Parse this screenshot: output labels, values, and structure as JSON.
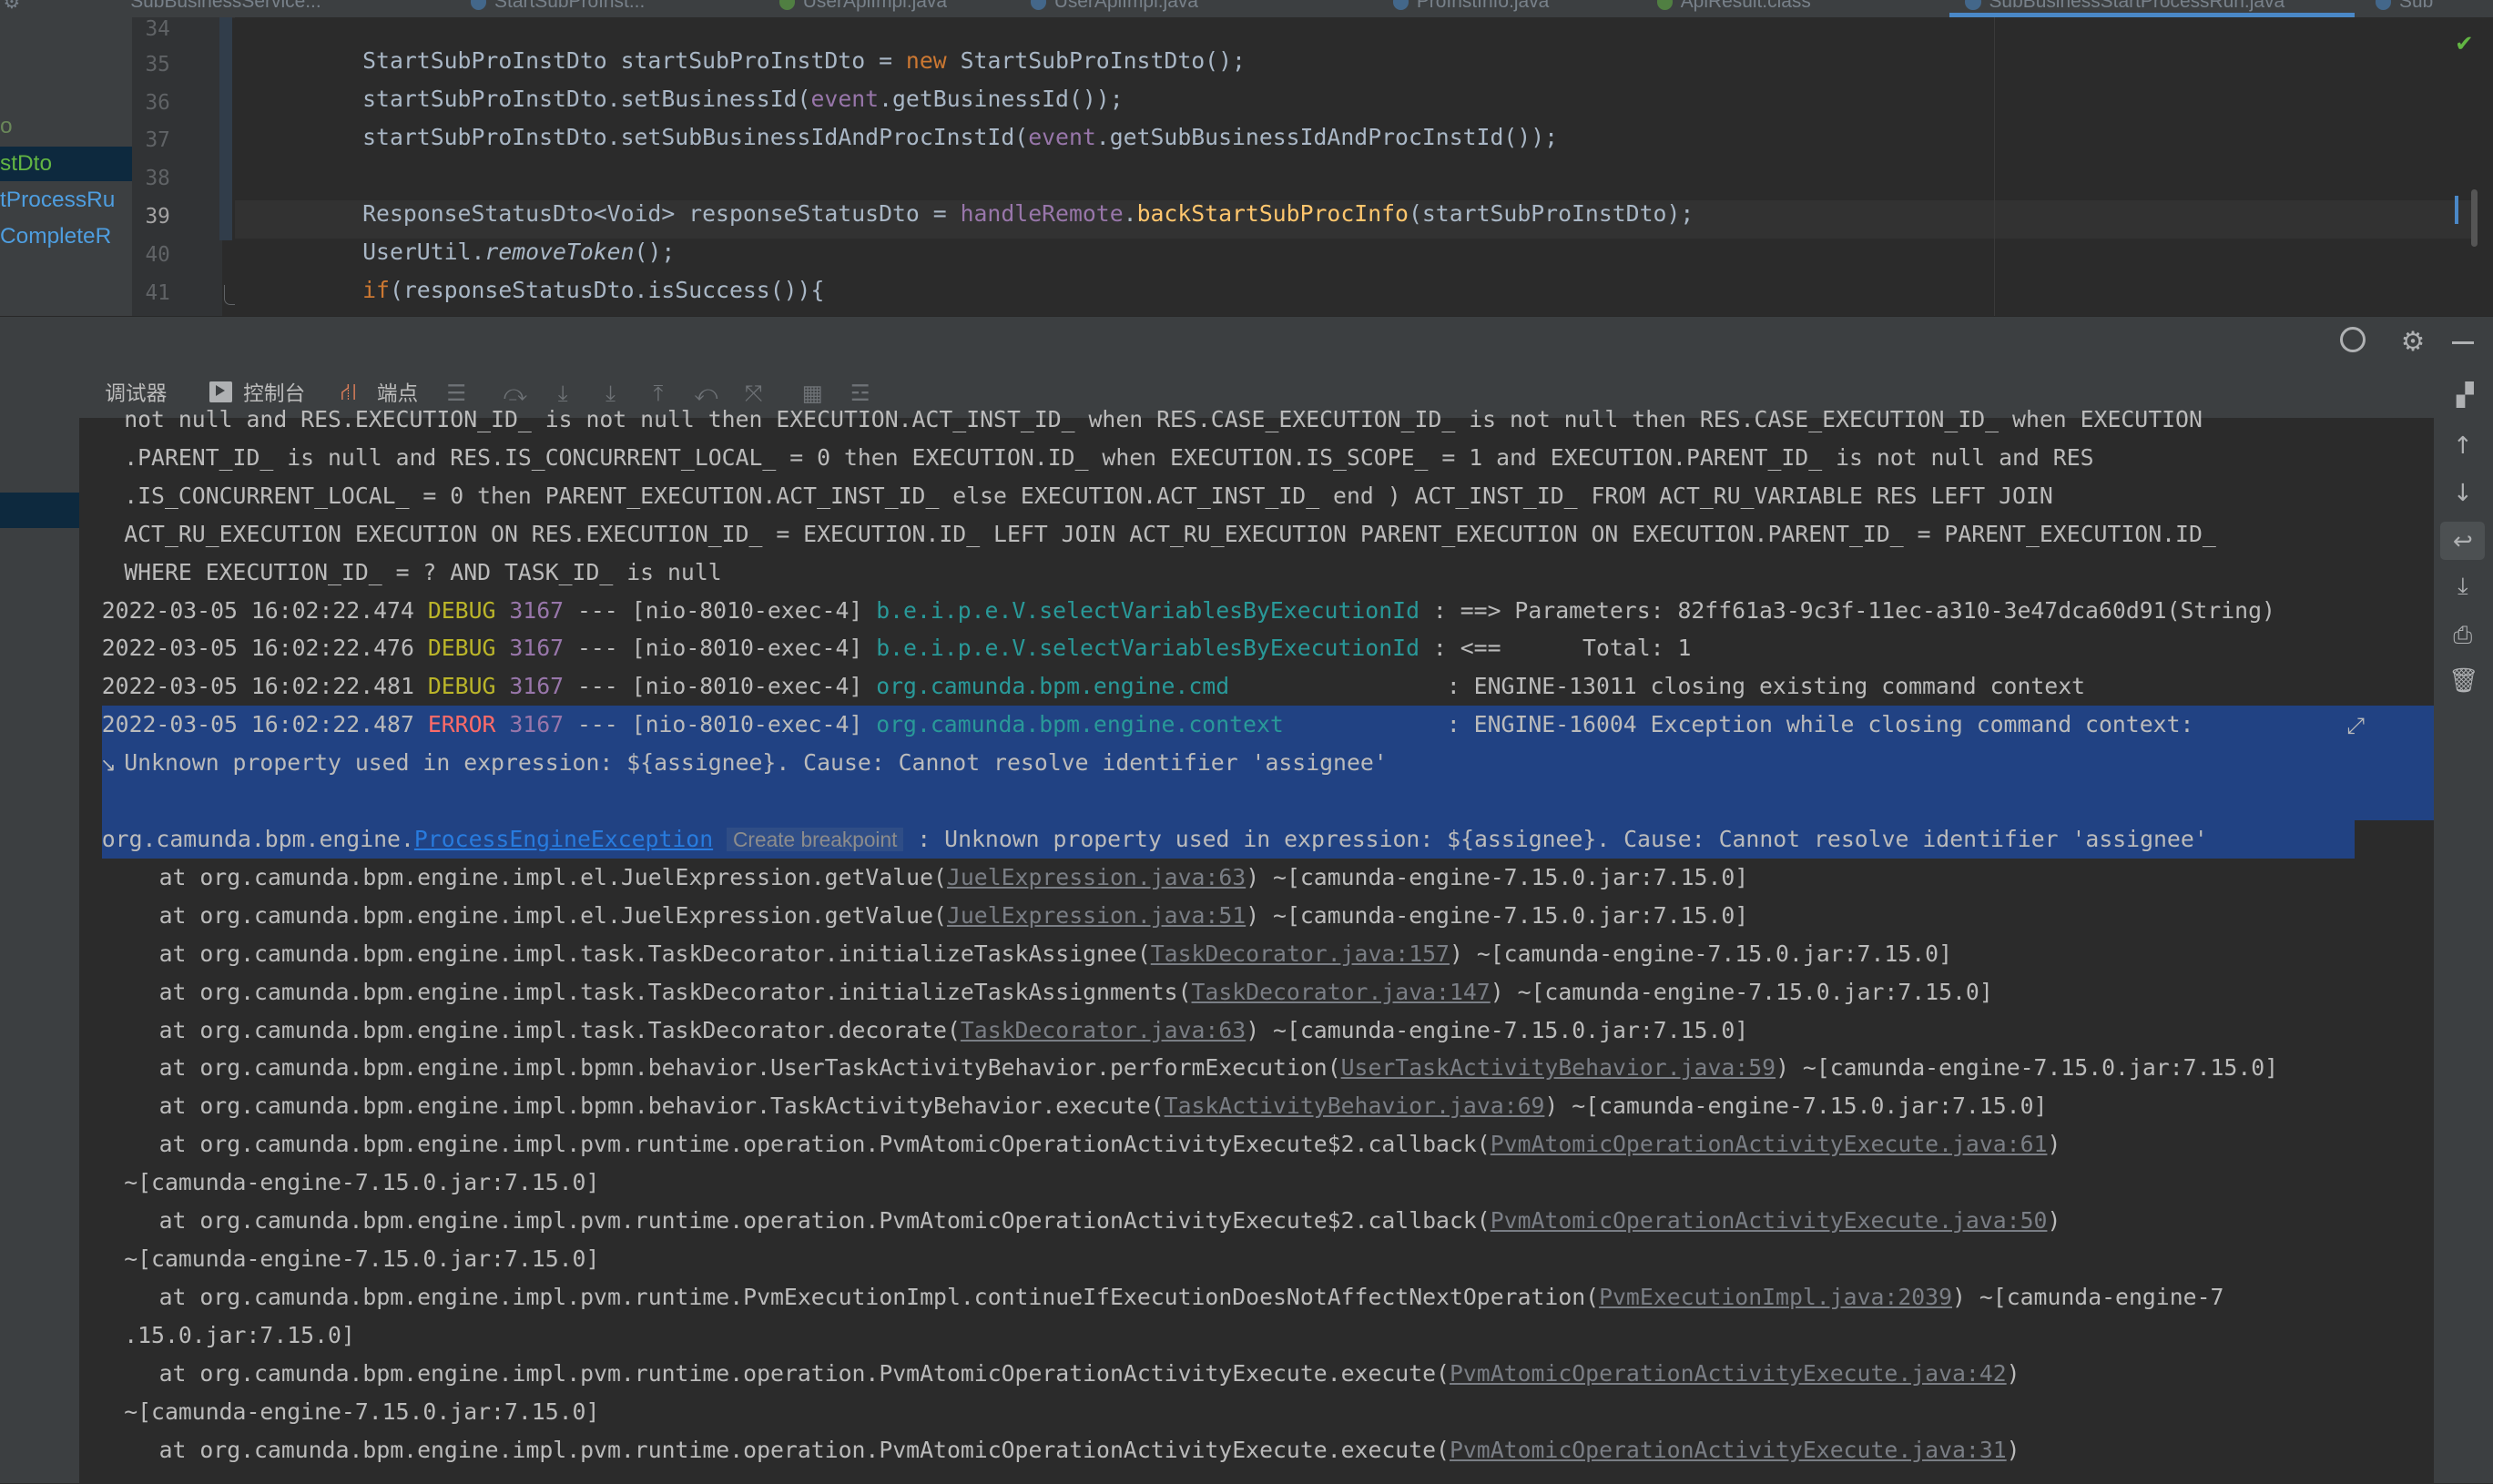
{
  "tabs": [
    "SubBusinessService...",
    "StartSubProInst...",
    "UserApiImpl.java",
    "UserApiImpl.java",
    "ProInstInfo.java",
    "ApiResult.class",
    "SubBusinessStartProcessRun.java",
    "Sub"
  ],
  "tree_items": [
    {
      "label": "o",
      "color": "#6a8759"
    },
    {
      "label": "stDto",
      "color": "#62b543"
    },
    {
      "label": "tProcessRu",
      "color": "#4e9ee0"
    },
    {
      "label": "CompleteR",
      "color": "#4e9ee0"
    }
  ],
  "editor": {
    "line_numbers": [
      "34",
      "35",
      "36",
      "37",
      "38",
      "39",
      "40",
      "41"
    ],
    "l35": {
      "a": "StartSubProInstDto startSubProInstDto = ",
      "b": "new",
      "c": " StartSubProInstDto();"
    },
    "l36": {
      "a": "startSubProInstDto.setBusinessId(",
      "b": "event",
      "c": ".getBusinessId());"
    },
    "l37": {
      "a": "startSubProInstDto.setSubBusinessIdAndProcInstId(",
      "b": "event",
      "c": ".getSubBusinessIdAndProcInstId());"
    },
    "l39": {
      "a": "ResponseStatusDto<Void> responseStatusDto = ",
      "b": "handleRemote",
      "c": ".",
      "d": "backStartSubProcInfo",
      "e": "(startSubProInstDto);"
    },
    "l40": {
      "a": "UserUtil.",
      "b": "removeToken",
      "c": "();"
    },
    "l41": {
      "a": "if",
      "b": "(responseStatusDto.isSuccess()){"
    }
  },
  "debug_tabs": {
    "debugger": "调试器",
    "console": "控制台",
    "endpoints": "端点"
  },
  "console": {
    "sql": [
      "not null and RES.EXECUTION_ID_ is not null then EXECUTION.ACT_INST_ID_ when RES.CASE_EXECUTION_ID_ is not null then RES.CASE_EXECUTION_ID_ when EXECUTION",
      ".PARENT_ID_ is null and RES.IS_CONCURRENT_LOCAL_ = 0 then EXECUTION.ID_ when EXECUTION.IS_SCOPE_ = 1 and EXECUTION.PARENT_ID_ is not null and RES",
      ".IS_CONCURRENT_LOCAL_ = 0 then PARENT_EXECUTION.ACT_INST_ID_ else EXECUTION.ACT_INST_ID_ end ) ACT_INST_ID_ FROM ACT_RU_VARIABLE RES LEFT JOIN",
      "ACT_RU_EXECUTION EXECUTION ON RES.EXECUTION_ID_ = EXECUTION.ID_ LEFT JOIN ACT_RU_EXECUTION PARENT_EXECUTION ON EXECUTION.PARENT_ID_ = PARENT_EXECUTION.ID_",
      "WHERE EXECUTION_ID_ = ? AND TASK_ID_ is null"
    ],
    "log": [
      {
        "ts": "2022-03-05 16:02:22.474",
        "level": "DEBUG",
        "pid": "3167",
        "thread": " --- [nio-8010-exec-4] ",
        "logger": "b.e.i.p.e.V.selectVariablesByExecutionId",
        "msg": " : ==> Parameters: 82ff61a3-9c3f-11ec-a310-3e47dca60d91(String)"
      },
      {
        "ts": "2022-03-05 16:02:22.476",
        "level": "DEBUG",
        "pid": "3167",
        "thread": " --- [nio-8010-exec-4] ",
        "logger": "b.e.i.p.e.V.selectVariablesByExecutionId",
        "msg": " : <==      Total: 1"
      },
      {
        "ts": "2022-03-05 16:02:22.481",
        "level": "DEBUG",
        "pid": "3167",
        "thread": " --- [nio-8010-exec-4] ",
        "logger": "org.camunda.bpm.engine.cmd               ",
        "msg": " : ENGINE-13011 closing existing command context"
      },
      {
        "ts": "2022-03-05 16:02:22.487",
        "level": "ERROR",
        "pid": "3167",
        "thread": " --- [nio-8010-exec-4] ",
        "logger": "org.camunda.bpm.engine.context           ",
        "msg": " : ENGINE-16004 Exception while closing command context:"
      }
    ],
    "wrap_cont": "Unknown property used in expression: ${assignee}. Cause: Cannot resolve identifier 'assignee'",
    "exception": {
      "prefix": "org.camunda.bpm.engine.",
      "link": "ProcessEngineException",
      "hint": "Create breakpoint",
      "msg": " : Unknown property used in expression: ${assignee}. Cause: Cannot resolve identifier 'assignee'"
    },
    "stack": [
      {
        "a": "at org.camunda.bpm.engine.impl.el.JuelExpression.getValue(",
        "l": "JuelExpression.java:63",
        "b": ") ~[camunda-engine-7.15.0.jar:7.15.0]"
      },
      {
        "a": "at org.camunda.bpm.engine.impl.el.JuelExpression.getValue(",
        "l": "JuelExpression.java:51",
        "b": ") ~[camunda-engine-7.15.0.jar:7.15.0]"
      },
      {
        "a": "at org.camunda.bpm.engine.impl.task.TaskDecorator.initializeTaskAssignee(",
        "l": "TaskDecorator.java:157",
        "b": ") ~[camunda-engine-7.15.0.jar:7.15.0]"
      },
      {
        "a": "at org.camunda.bpm.engine.impl.task.TaskDecorator.initializeTaskAssignments(",
        "l": "TaskDecorator.java:147",
        "b": ") ~[camunda-engine-7.15.0.jar:7.15.0]"
      },
      {
        "a": "at org.camunda.bpm.engine.impl.task.TaskDecorator.decorate(",
        "l": "TaskDecorator.java:63",
        "b": ") ~[camunda-engine-7.15.0.jar:7.15.0]"
      },
      {
        "a": "at org.camunda.bpm.engine.impl.bpmn.behavior.UserTaskActivityBehavior.performExecution(",
        "l": "UserTaskActivityBehavior.java:59",
        "b": ") ~[camunda-engine-7.15.0.jar:7.15.0]"
      },
      {
        "a": "at org.camunda.bpm.engine.impl.bpmn.behavior.TaskActivityBehavior.execute(",
        "l": "TaskActivityBehavior.java:69",
        "b": ") ~[camunda-engine-7.15.0.jar:7.15.0]"
      },
      {
        "a": "at org.camunda.bpm.engine.impl.pvm.runtime.operation.PvmAtomicOperationActivityExecute$2.callback(",
        "l": "PvmAtomicOperationActivityExecute.java:61",
        "b": ")"
      },
      {
        "a": "at org.camunda.bpm.engine.impl.pvm.runtime.operation.PvmAtomicOperationActivityExecute$2.callback(",
        "l": "PvmAtomicOperationActivityExecute.java:50",
        "b": ")"
      },
      {
        "a": "at org.camunda.bpm.engine.impl.pvm.runtime.PvmExecutionImpl.continueIfExecutionDoesNotAffectNextOperation(",
        "l": "PvmExecutionImpl.java:2039",
        "b": ") ~[camunda-engine-7"
      },
      {
        "a": "at org.camunda.bpm.engine.impl.pvm.runtime.operation.PvmAtomicOperationActivityExecute.execute(",
        "l": "PvmAtomicOperationActivityExecute.java:42",
        "b": ")"
      },
      {
        "a": "at org.camunda.bpm.engine.impl.pvm.runtime.operation.PvmAtomicOperationActivityExecute.execute(",
        "l": "PvmAtomicOperationActivityExecute.java:31",
        "b": ")"
      }
    ],
    "jar_wrap": "~[camunda-engine-7.15.0.jar:7.15.0]",
    "jar_wrap2": ".15.0.jar:7.15.0]"
  }
}
